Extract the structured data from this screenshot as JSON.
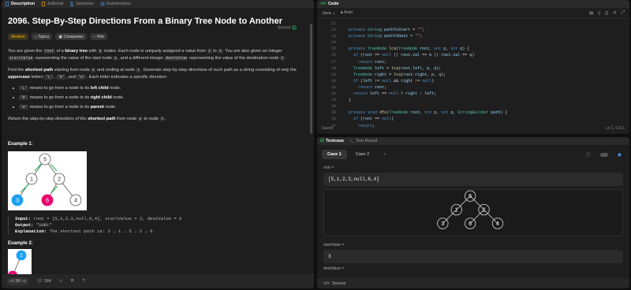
{
  "left_tabs": [
    "Description",
    "Editorial",
    "Solutions",
    "Submissions"
  ],
  "problem": {
    "title": "2096. Step-By-Step Directions From a Binary Tree Node to Another",
    "solved": "Solved",
    "difficulty": "Medium",
    "chips": [
      "Topics",
      "Companies",
      "Hint"
    ],
    "p1": [
      {
        "t": "You are given the "
      },
      {
        "c": "root"
      },
      {
        "t": " of a "
      },
      {
        "b": "binary tree"
      },
      {
        "t": " with "
      },
      {
        "c": "n"
      },
      {
        "t": " nodes. Each node is uniquely assigned a value from "
      },
      {
        "c": "1"
      },
      {
        "t": " to "
      },
      {
        "c": "n"
      },
      {
        "t": ". You are also given an integer "
      },
      {
        "c": "startValue"
      },
      {
        "t": " representing the value of the start node "
      },
      {
        "c": "s"
      },
      {
        "t": ", and a different integer "
      },
      {
        "c": "destValue"
      },
      {
        "t": " representing the value of the destination node "
      },
      {
        "c": "t"
      },
      {
        "t": "."
      }
    ],
    "p2": [
      {
        "t": "Find the "
      },
      {
        "b": "shortest path"
      },
      {
        "t": " starting from node "
      },
      {
        "c": "s"
      },
      {
        "t": " and ending at node "
      },
      {
        "c": "t"
      },
      {
        "t": ". Generate step-by-step directions of such path as a string consisting of only the "
      },
      {
        "b": "uppercase"
      },
      {
        "t": " letters "
      },
      {
        "c": "'L'"
      },
      {
        "t": ", "
      },
      {
        "c": "'R'"
      },
      {
        "t": ", and "
      },
      {
        "c": "'U'"
      },
      {
        "t": ". Each letter indicates a specific direction:"
      }
    ],
    "bullets": [
      {
        "code": "'L'",
        "pre": " means to go from a node to its ",
        "bold": "left child",
        "post": " node."
      },
      {
        "code": "'R'",
        "pre": " means to go from a node to its ",
        "bold": "right child",
        "post": " node."
      },
      {
        "code": "'U'",
        "pre": " means to go from a node to its ",
        "bold": "parent",
        "post": " node."
      }
    ],
    "p3": [
      {
        "t": "Return the step-by-step directions of the "
      },
      {
        "b": "shortest path"
      },
      {
        "t": " from node "
      },
      {
        "c": "s"
      },
      {
        "t": " to node "
      },
      {
        "c": "t"
      },
      {
        "t": "."
      }
    ],
    "example1": {
      "heading": "Example 1:",
      "input_label": "Input:",
      "input": "root = [5,1,2,3,null,6,4], startValue = 3, destValue = 6",
      "output_label": "Output:",
      "output": "\"UURL\"",
      "expl_label": "Explanation:",
      "expl": "The shortest path is: 3 → 1 → 5 → 2 → 6."
    },
    "example2_heading": "Example 2:",
    "tree1": {
      "nodes": [
        "5",
        "1",
        "2",
        "3",
        "6",
        "4"
      ]
    },
    "tree2": {
      "nodes": [
        "2",
        "1"
      ]
    }
  },
  "footer": {
    "likes": "3K",
    "comments": "164"
  },
  "code": {
    "title": "Code",
    "language": "Java",
    "mode": "Auto",
    "status": "Saved",
    "position": "Ln 1, Col 1",
    "lines": [
      {
        "n": "21",
        "html": ""
      },
      {
        "n": "22",
        "html": "  <span class='kw'>private</span> <span class='ty'>String</span> <span class='vr'>pathToStart</span> = <span class='st'>\"\"</span>;"
      },
      {
        "n": "23",
        "html": "  <span class='kw'>private</span> <span class='ty'>String</span> <span class='vr'>pathToDest</span> = <span class='st'>\"\"</span>;"
      },
      {
        "n": "24",
        "html": ""
      },
      {
        "n": "25",
        "html": "  <span class='kw'>private</span> <span class='ty'>TreeNode</span> <span class='fn'>lca</span>(<span class='ty'>TreeNode</span> <span class='vr'>root</span>, <span class='kw'>int</span> <span class='vr'>p</span>, <span class='kw'>int</span> <span class='vr'>q</span>) {"
      },
      {
        "n": "26",
        "html": "    <span class='kw'>if</span> (<span class='vr'>root</span> == <span class='kw'>null</span> || <span class='vr'>root</span>.<span class='vr'>val</span> == <span class='vr'>p</span> || <span class='vr'>root</span>.<span class='vr'>val</span> == <span class='vr'>q</span>)"
      },
      {
        "n": "27",
        "html": "      <span class='kw'>return</span> <span class='vr'>root</span>;"
      },
      {
        "n": "28",
        "html": "    <span class='ty'>TreeNode</span> <span class='vr'>left</span> = <span class='fn'>lca</span>(<span class='vr'>root</span>.<span class='vr'>left</span>, <span class='vr'>p</span>, <span class='vr'>q</span>);"
      },
      {
        "n": "29",
        "html": "    <span class='ty'>TreeNode</span> <span class='vr'>right</span> = <span class='fn'>lca</span>(<span class='vr'>root</span>.<span class='vr'>right</span>, <span class='vr'>p</span>, <span class='vr'>q</span>);"
      },
      {
        "n": "30",
        "html": "    <span class='kw'>if</span> (<span class='vr'>left</span> != <span class='kw'>null</span> &amp;&amp; <span class='vr'>right</span> != <span class='kw'>null</span>)"
      },
      {
        "n": "31",
        "html": "      <span class='kw'>return</span> <span class='vr'>root</span>;"
      },
      {
        "n": "32",
        "html": "    <span class='kw'>return</span> <span class='vr'>left</span> == <span class='kw'>null</span> ? <span class='vr'>right</span> : <span class='vr'>left</span>;"
      },
      {
        "n": "33",
        "html": "  }"
      },
      {
        "n": "34",
        "html": ""
      },
      {
        "n": "35",
        "html": "  <span class='kw'>private</span> <span class='kw'>void</span> <span class='fn'>dfs</span>(<span class='ty'>TreeNode</span> <span class='vr'>root</span>, <span class='kw'>int</span> <span class='vr'>p</span>, <span class='kw'>int</span> <span class='vr'>q</span>, <span class='ty'>StringBuilder</span> <span class='vr'>path</span>) {"
      },
      {
        "n": "36",
        "html": "    <span class='kw'>if</span> (<span class='vr'>root</span> == <span class='kw'>null</span>)"
      },
      {
        "n": "37",
        "html": "      <span class='kw'>return</span>;"
      }
    ]
  },
  "testpanel": {
    "tabs": [
      "Testcase",
      "Test Result"
    ],
    "cases": [
      "Case 1",
      "Case 2"
    ],
    "add": "+",
    "root_label": "root =",
    "root_value": "[5,1,2,3,null,6,4]",
    "tree_nodes": [
      "5",
      "1",
      "2",
      "3",
      "6",
      "4"
    ],
    "start_label": "startValue =",
    "start_value": "3",
    "dest_label": "destValue =",
    "source": "Source"
  },
  "colors": {
    "accent": "#ffb800",
    "start_node": "#1da1f2",
    "dest_node": "#e8006f",
    "solved": "#2cbb5d"
  }
}
